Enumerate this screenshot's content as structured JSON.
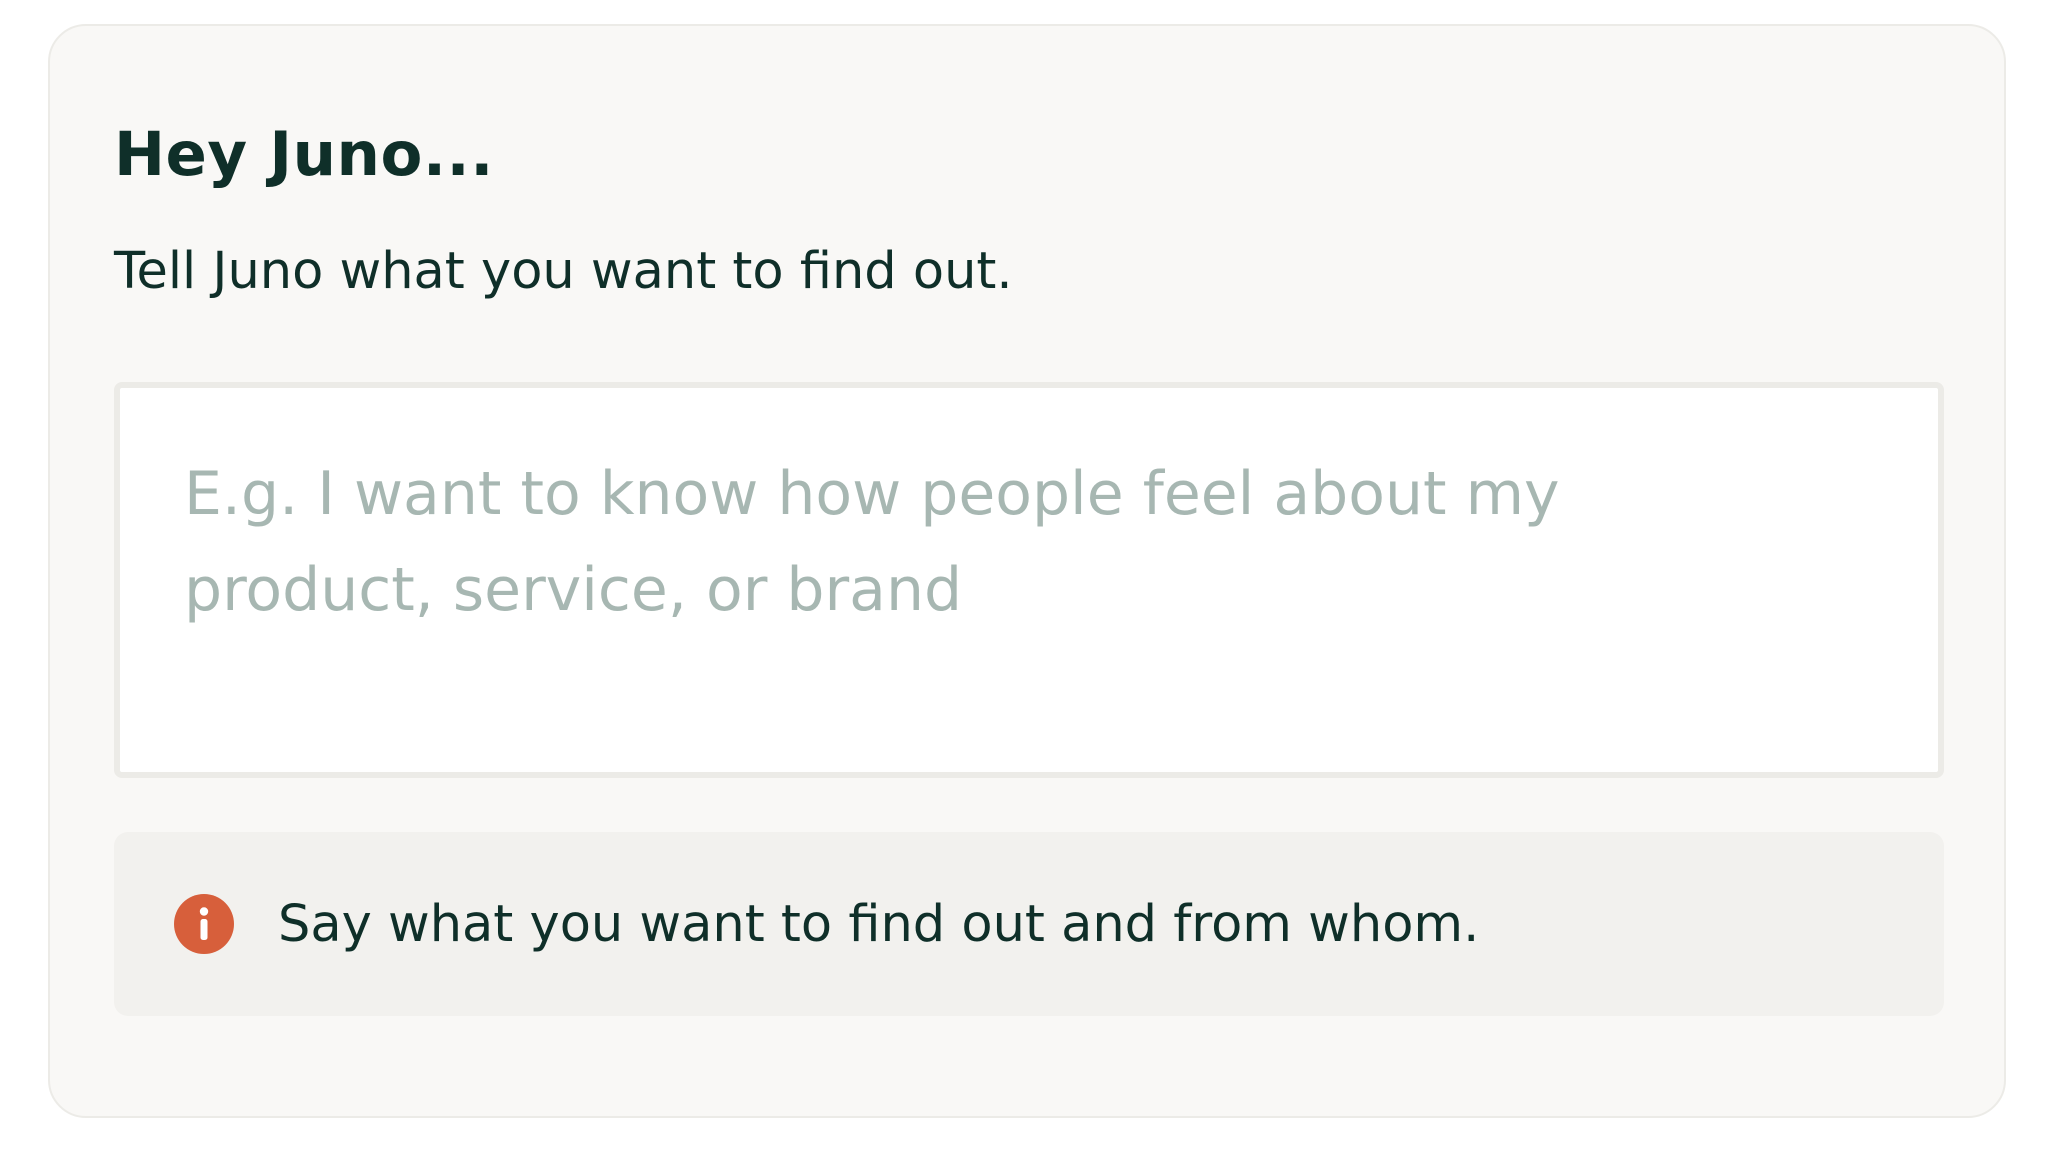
{
  "header": {
    "title": "Hey Juno...",
    "subtitle": "Tell Juno what you want to find out."
  },
  "prompt_input": {
    "value": "",
    "placeholder": "E.g. I want to know how people feel about my product, service, or brand"
  },
  "hint": {
    "icon": "info-icon",
    "text": "Say what you want to find out and from whom."
  },
  "colors": {
    "text": "#0f2f29",
    "placeholder": "#a7b7b2",
    "card_background": "#f9f8f6",
    "hint_background": "#f2f1ee",
    "info_accent": "#d75f3b"
  }
}
